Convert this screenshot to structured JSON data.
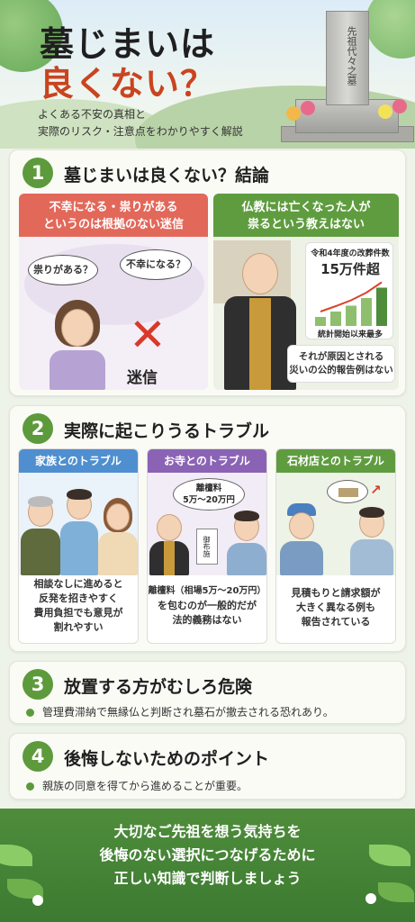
{
  "hero": {
    "title_line1": "墓じまいは",
    "title_line2": "良くない？",
    "subtitle_line1": "よくある不安の真相と",
    "subtitle_line2": "実際のリスク・注意点をわかりやすく解説",
    "tombstone_text": "先祖代々之墓"
  },
  "section1": {
    "number": "1",
    "title": "墓じまいは良くない？結論",
    "left_panel": {
      "head_line1": "不幸になる・祟りがある",
      "head_line2": "というのは根拠のない迷信",
      "bubble1": "祟りがある？",
      "bubble2": "不幸になる？",
      "stamp": "迷信",
      "color": "#e2685a"
    },
    "right_panel": {
      "head_line1": "仏教には亡くなった人が",
      "head_line2": "祟るという教えはない",
      "stat_label": "令和4年度の改葬件数",
      "stat_value": "15万件超",
      "stat_note": "統計開始以来最多",
      "note_line1": "それが原因とされる",
      "note_line2": "災いの公的報告例はない",
      "bars": [
        0.2,
        0.32,
        0.45,
        0.62,
        0.85
      ],
      "color": "#5f9c3f"
    }
  },
  "section2": {
    "number": "2",
    "title": "実際に起こりうるトラブル",
    "cards": [
      {
        "head": "家族とのトラブル",
        "color": "#4f8fcf",
        "line1": "相談なしに進めると",
        "line2": "反発を招きやすく",
        "line3": "費用負担でも意見が",
        "line4": "割れやすい"
      },
      {
        "head": "お寺とのトラブル",
        "color": "#8a63b5",
        "callout_line1": "離檀料",
        "callout_line2": "5万〜20万円",
        "envelope": "御布施",
        "line1": "離檀料（相場5万〜20万円）",
        "line2": "を包むのが一般的だが",
        "line3": "法的義務はない",
        "line4": ""
      },
      {
        "head": "石材店とのトラブル",
        "color": "#5f9c3f",
        "line1": "見積もりと請求額が",
        "line2": "大きく異なる例も",
        "line3": "報告されている",
        "line4": ""
      }
    ]
  },
  "section3": {
    "number": "3",
    "title": "放置する方がむしろ危険",
    "bullet": "管理費滞納で無縁仏と判断され墓石が撤去される恐れあり。"
  },
  "section4": {
    "number": "4",
    "title": "後悔しないためのポイント",
    "bullet": "親族の同意を得てから進めることが重要。"
  },
  "footer": {
    "line1": "大切なご先祖を想う気持ちを",
    "line2": "後悔のない選択につなげるために",
    "line3": "正しい知識で判断しましょう"
  }
}
